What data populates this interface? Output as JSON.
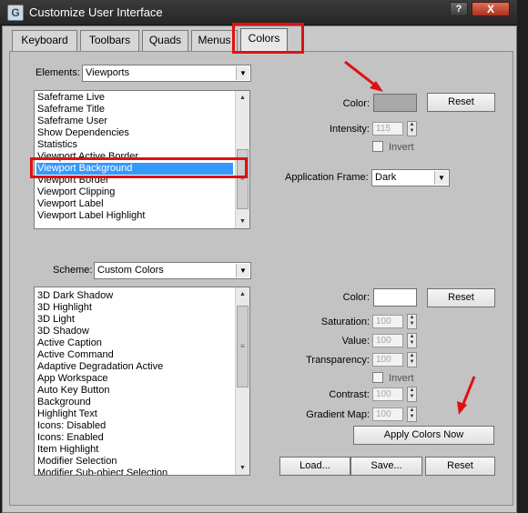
{
  "window": {
    "title": "Customize User Interface",
    "icon_glyph": "G",
    "help_label": "?",
    "close_label": "X"
  },
  "tabs": [
    {
      "label": "Keyboard",
      "active": false
    },
    {
      "label": "Toolbars",
      "active": false
    },
    {
      "label": "Quads",
      "active": false
    },
    {
      "label": "Menus",
      "active": false
    },
    {
      "label": "Colors",
      "active": true
    }
  ],
  "elements": {
    "label": "Elements:",
    "selected": "Viewports",
    "items": [
      "Safeframe Live",
      "Safeframe Title",
      "Safeframe User",
      "Show Dependencies",
      "Statistics",
      "Viewport Active Border",
      "Viewport Background",
      "Viewport Border",
      "Viewport Clipping",
      "Viewport Label",
      "Viewport Label Highlight"
    ],
    "selected_item": "Viewport Background"
  },
  "element_color": {
    "color_label": "Color:",
    "color_value": "#a9a9a9",
    "reset_label": "Reset",
    "intensity_label": "Intensity:",
    "intensity_value": "115",
    "invert_label": "Invert",
    "app_frame_label": "Application Frame:",
    "app_frame_value": "Dark"
  },
  "scheme": {
    "label": "Scheme:",
    "selected": "Custom Colors",
    "items": [
      "3D Dark Shadow",
      "3D Highlight",
      "3D Light",
      "3D Shadow",
      "Active Caption",
      "Active Command",
      "Adaptive Degradation Active",
      "App Workspace",
      "Auto Key Button",
      "Background",
      "Highlight Text",
      "Icons: Disabled",
      "Icons: Enabled",
      "Item Highlight",
      "Modifier Selection",
      "Modifier Sub-object Selection"
    ]
  },
  "scheme_color": {
    "color_label": "Color:",
    "color_value": "#ffffff",
    "reset_label": "Reset",
    "saturation_label": "Saturation:",
    "saturation_value": "100",
    "value_label": "Value:",
    "value_value": "100",
    "transparency_label": "Transparency:",
    "transparency_value": "100",
    "invert_label": "Invert",
    "contrast_label": "Contrast:",
    "contrast_value": "100",
    "gradient_label": "Gradient Map:",
    "gradient_value": "100",
    "apply_label": "Apply Colors Now"
  },
  "footer": {
    "load_label": "Load...",
    "save_label": "Save...",
    "reset_label": "Reset"
  },
  "colors": {
    "annotation": "#e01010",
    "selection": "#3399ff"
  },
  "icons": [
    "app-icon",
    "help-icon",
    "close-icon",
    "dropdown-arrow-icon",
    "scroll-up-icon",
    "scroll-down-icon",
    "spinner-up-icon",
    "spinner-down-icon",
    "annotation-arrow-icon"
  ]
}
